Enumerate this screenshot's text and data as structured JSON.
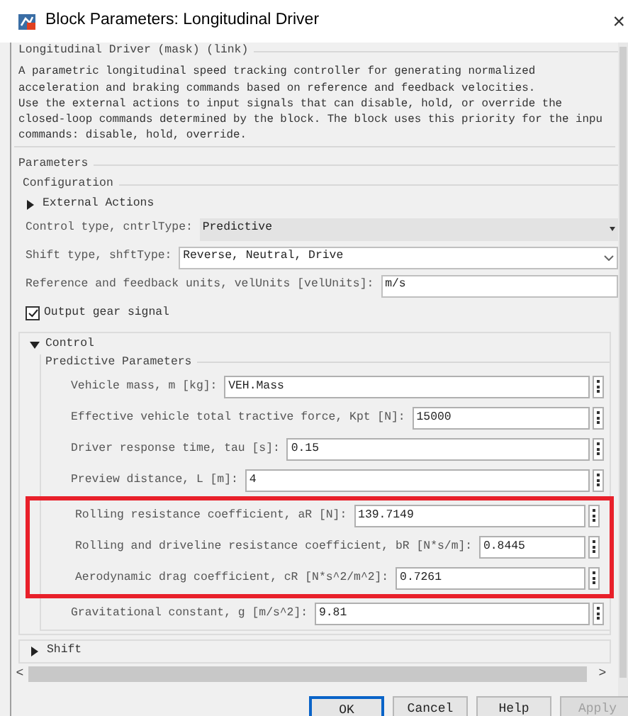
{
  "window": {
    "title": "Block Parameters: Longitudinal Driver",
    "close": "×"
  },
  "mask_title": "Longitudinal Driver (mask) (link)",
  "description": [
    "A parametric longitudinal speed tracking controller for generating normalized",
    "acceleration and braking commands based on reference and feedback velocities.",
    "Use the external actions to input signals that can disable, hold, or override the",
    "closed-loop commands determined by the block. The block uses this priority for the inpu",
    "commands: disable, hold, override."
  ],
  "parameters": {
    "title": "Parameters",
    "configuration": {
      "title": "Configuration",
      "external_actions": {
        "label": "External Actions",
        "expanded": false
      },
      "fields": [
        {
          "kind": "dropdown",
          "label": "Control type, cntrlType:",
          "value": "Predictive",
          "disabled": true
        },
        {
          "kind": "dropdown",
          "label": "Shift type, shftType:",
          "value": "Reverse, Neutral, Drive",
          "disabled": false
        },
        {
          "kind": "text",
          "label": "Reference and feedback units, velUnits [velUnits]:",
          "value": "m/s"
        }
      ],
      "checkbox": {
        "label": "Output gear signal",
        "checked": true
      }
    },
    "control": {
      "label": "Control",
      "expanded": true,
      "group": "Predictive Parameters",
      "fields": [
        {
          "label": "Vehicle mass, m [kg]:",
          "value": "VEH.Mass",
          "highlighted": false
        },
        {
          "label": "Effective vehicle total tractive force, Kpt [N]:",
          "value": "15000",
          "highlighted": false
        },
        {
          "label": "Driver response time, tau [s]:",
          "value": "0.15",
          "highlighted": false
        },
        {
          "label": "Preview distance, L [m]:",
          "value": "4",
          "highlighted": false
        },
        {
          "label": "Rolling resistance coefficient, aR [N]:",
          "value": "139.7149",
          "highlighted": true
        },
        {
          "label": "Rolling and driveline resistance coefficient, bR [N*s/m]:",
          "value": "0.8445",
          "highlighted": true
        },
        {
          "label": "Aerodynamic drag coefficient, cR [N*s^2/m^2]:",
          "value": "0.7261",
          "highlighted": true
        },
        {
          "label": "Gravitational constant, g [m/s^2]:",
          "value": "9.81",
          "highlighted": false
        }
      ]
    },
    "shift": {
      "label": "Shift",
      "expanded": false
    }
  },
  "scrollbar": {
    "left": "<",
    "right": ">"
  },
  "buttons": [
    {
      "label": "OK",
      "default": true,
      "disabled": false
    },
    {
      "label": "Cancel",
      "default": false,
      "disabled": false
    },
    {
      "label": "Help",
      "default": false,
      "disabled": false
    },
    {
      "label": "Apply",
      "default": false,
      "disabled": true
    }
  ]
}
